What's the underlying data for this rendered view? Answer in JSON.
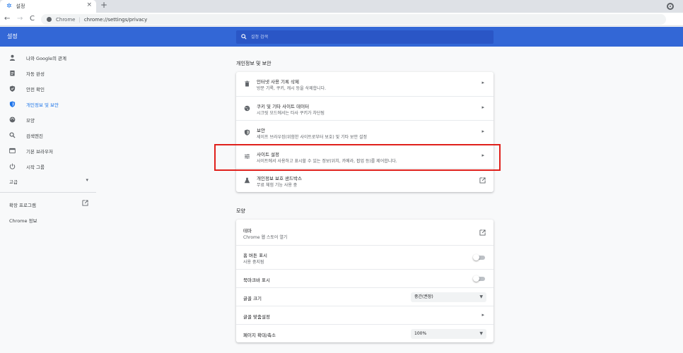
{
  "tab": {
    "title": "설정",
    "close": "×",
    "new_tab": "+"
  },
  "omnibox": {
    "host": "Chrome",
    "separator": "|",
    "url": "chrome://settings/privacy"
  },
  "nav": {
    "back": "←",
    "forward": "→",
    "reload": "C"
  },
  "header": {
    "title": "설정",
    "search_placeholder": "설정 검색"
  },
  "sidebar": {
    "items": [
      {
        "label": "나와 Google의 관계"
      },
      {
        "label": "자동 완성"
      },
      {
        "label": "안전 확인"
      },
      {
        "label": "개인정보 및 보안"
      },
      {
        "label": "모양"
      },
      {
        "label": "검색엔진"
      },
      {
        "label": "기본 브라우저"
      },
      {
        "label": "시작 그룹"
      }
    ],
    "advanced": "고급",
    "extensions": "확장 프로그램",
    "about": "Chrome 정보"
  },
  "privacy": {
    "title": "개인정보 및 보안",
    "rows": [
      {
        "title": "인터넷 사용 기록 삭제",
        "subtitle": "방문 기록, 쿠키, 캐시 등을 삭제합니다."
      },
      {
        "title": "쿠키 및 기타 사이트 데이터",
        "subtitle": "시크릿 모드에서는 타사 쿠키가 차단됨"
      },
      {
        "title": "보안",
        "subtitle": "세이프 브라우징(위험한 사이트로부터 보호) 및 기타 보안 설정"
      },
      {
        "title": "사이트 설정",
        "subtitle": "사이트에서 사용하고 표시할 수 있는 정보(위치, 카메라, 팝업 등)를 제어합니다."
      },
      {
        "title": "개인정보 보호 샌드박스",
        "subtitle": "무료 체험 기능 사용 중"
      }
    ]
  },
  "appearance": {
    "title": "모양",
    "theme": {
      "title": "테마",
      "subtitle": "Chrome 웹 스토어 열기"
    },
    "home_button": {
      "title": "홈 버튼 표시",
      "subtitle": "사용 중지됨"
    },
    "bookmarks_bar": {
      "title": "북마크바 표시"
    },
    "font_size": {
      "title": "글꼴 크기",
      "value": "중간(권장)"
    },
    "customize_fonts": {
      "title": "글꼴 맞춤설정"
    },
    "page_zoom": {
      "title": "페이지 확대/축소",
      "value": "100%"
    }
  },
  "colors": {
    "header": "#3367d6",
    "accent": "#1a73e8",
    "highlight": "#e0201b"
  }
}
